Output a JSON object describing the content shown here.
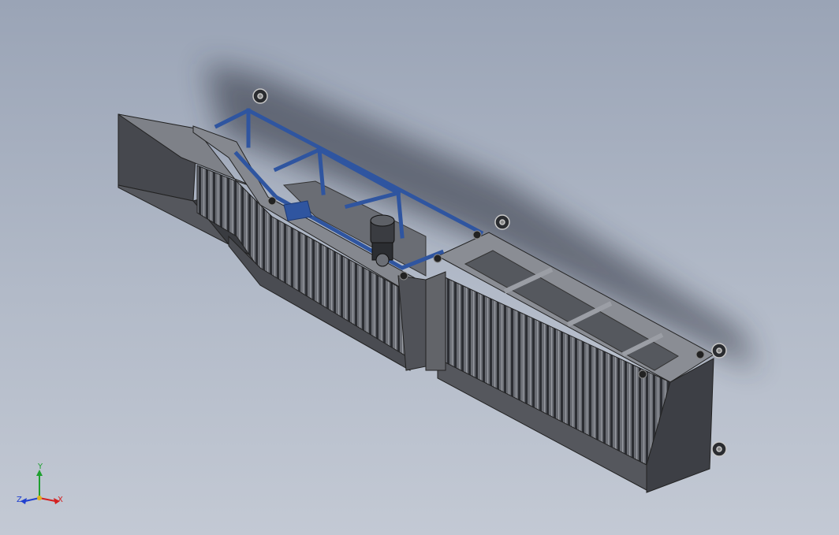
{
  "viewport": {
    "background_top": "#9aa4b6",
    "background_bottom": "#c3c9d4",
    "model": "feeder-chute-assembly"
  },
  "colors": {
    "steel_dark": "#3f4146",
    "steel_mid": "#5c5e64",
    "steel_light": "#8a8d94",
    "frame_blue": "#2f55a0",
    "axis_x": "#d42020",
    "axis_y": "#1fa030",
    "axis_z": "#2040d0"
  },
  "triad": {
    "x_label": "X",
    "y_label": "Y",
    "z_label": "Z"
  }
}
